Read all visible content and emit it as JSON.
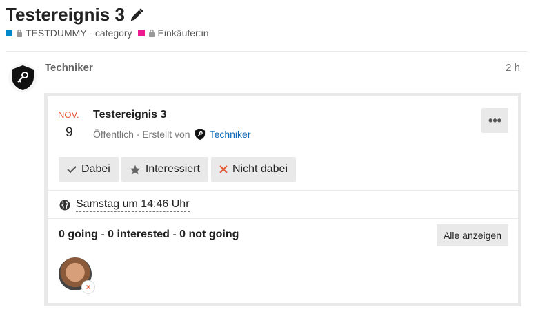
{
  "topic": {
    "title": "Testereignis 3",
    "categories": [
      {
        "label": "TESTDUMMY - category",
        "color": "#0088cc"
      },
      {
        "label": "Einkäufer:in",
        "color": "#e91e8c"
      }
    ]
  },
  "post": {
    "username": "Techniker",
    "age": "2 h"
  },
  "event": {
    "month": "NOV.",
    "day": "9",
    "name": "Testereignis 3",
    "status_prefix": "Öffentlich · Erstellt von",
    "creator": "Techniker",
    "more_label": "•••",
    "rsvp": {
      "going": "Dabei",
      "interested": "Interessiert",
      "not_going": "Nicht dabei"
    },
    "time": "Samstag um 14:46 Uhr",
    "counts": {
      "going": "0 going",
      "interested": "0 interested",
      "not_going": "0 not going",
      "separator": "-"
    },
    "show_all": "Alle anzeigen",
    "attendee_badge": "×"
  },
  "colors": {
    "accent_red": "#e45735",
    "link_blue": "#0a6ab8",
    "button_gray": "#e9e9e9"
  }
}
